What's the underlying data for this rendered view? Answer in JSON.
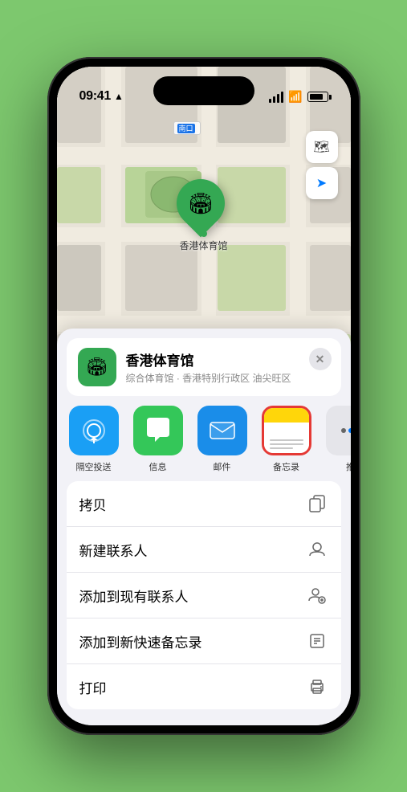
{
  "status": {
    "time": "09:41",
    "direction_arrow": "▶"
  },
  "map": {
    "label": "南口",
    "map_icon": "🗺",
    "location_icon": "◉",
    "controls": {
      "map_type": "🗺",
      "location": "➤"
    }
  },
  "pin": {
    "label": "香港体育馆",
    "emoji": "🏟"
  },
  "location_card": {
    "name": "香港体育馆",
    "address": "综合体育馆 · 香港特别行政区 油尖旺区",
    "close": "✕"
  },
  "share_items": [
    {
      "label": "隔空投送",
      "type": "airdrop"
    },
    {
      "label": "信息",
      "type": "messages"
    },
    {
      "label": "邮件",
      "type": "mail"
    },
    {
      "label": "备忘录",
      "type": "notes"
    }
  ],
  "action_items": [
    {
      "label": "拷贝",
      "icon": "copy"
    },
    {
      "label": "新建联系人",
      "icon": "person_add"
    },
    {
      "label": "添加到现有联系人",
      "icon": "person_plus"
    },
    {
      "label": "添加到新快速备忘录",
      "icon": "note_add"
    },
    {
      "label": "打印",
      "icon": "print"
    }
  ]
}
